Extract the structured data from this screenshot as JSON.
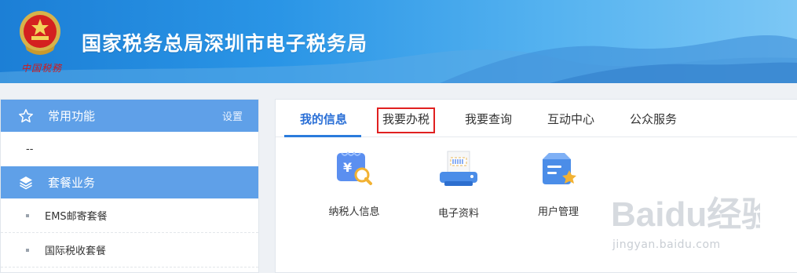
{
  "header": {
    "title": "国家税务总局深圳市电子税务局",
    "emblem_caption": "中国税務"
  },
  "sidebar": {
    "favorites": {
      "label": "常用功能",
      "setting_label": "设置",
      "empty_text": "--"
    },
    "packages": {
      "label": "套餐业务",
      "items": [
        {
          "label": "EMS邮寄套餐"
        },
        {
          "label": "国际税收套餐"
        }
      ]
    }
  },
  "tabs": [
    {
      "label": "我的信息",
      "active": true
    },
    {
      "label": "我要办税",
      "highlighted": true
    },
    {
      "label": "我要查询"
    },
    {
      "label": "互动中心"
    },
    {
      "label": "公众服务"
    }
  ],
  "functions": [
    {
      "label": "纳税人信息",
      "icon": "taxpayer-info-icon"
    },
    {
      "label": "电子资料",
      "icon": "e-document-printer-icon"
    },
    {
      "label": "用户管理",
      "icon": "user-management-icon"
    }
  ],
  "watermark": {
    "brand": "Baidu经验",
    "url": "jingyan.baidu.com"
  },
  "colors": {
    "accent": "#2a6fd6",
    "sidebar_head": "#5fa0e8",
    "highlight": "#e02020"
  }
}
